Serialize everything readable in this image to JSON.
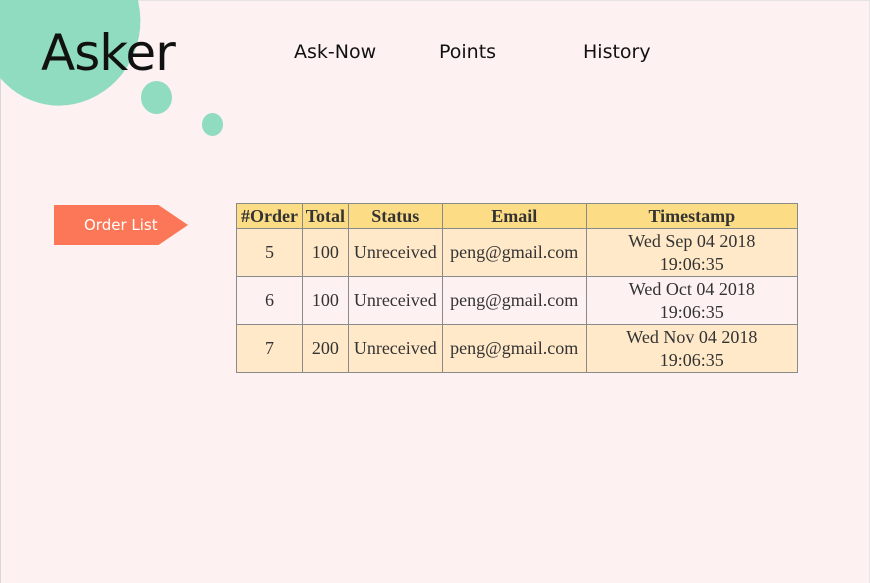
{
  "brand": {
    "logo": "Asker",
    "accent": "#8fdcc1"
  },
  "nav": [
    {
      "label": "Ask-Now"
    },
    {
      "label": "Points"
    },
    {
      "label": "History"
    }
  ],
  "sidebar": {
    "order_list_label": "Order List",
    "color": "#fb7757"
  },
  "table": {
    "columns": [
      "#Order",
      "Total",
      "Status",
      "Email",
      "Timestamp"
    ],
    "rows": [
      {
        "order": "5",
        "total": "100",
        "status": "Unreceived",
        "email": "peng@gmail.com",
        "timestamp_date": "Wed Sep 04 2018",
        "timestamp_time": "19:06:35"
      },
      {
        "order": "6",
        "total": "100",
        "status": "Unreceived",
        "email": "peng@gmail.com",
        "timestamp_date": "Wed Oct 04 2018",
        "timestamp_time": "19:06:35"
      },
      {
        "order": "7",
        "total": "200",
        "status": "Unreceived",
        "email": "peng@gmail.com",
        "timestamp_date": "Wed Nov 04 2018",
        "timestamp_time": "19:06:35"
      }
    ],
    "header_color": "#fddc86",
    "row_color": "#ffe9c9"
  }
}
